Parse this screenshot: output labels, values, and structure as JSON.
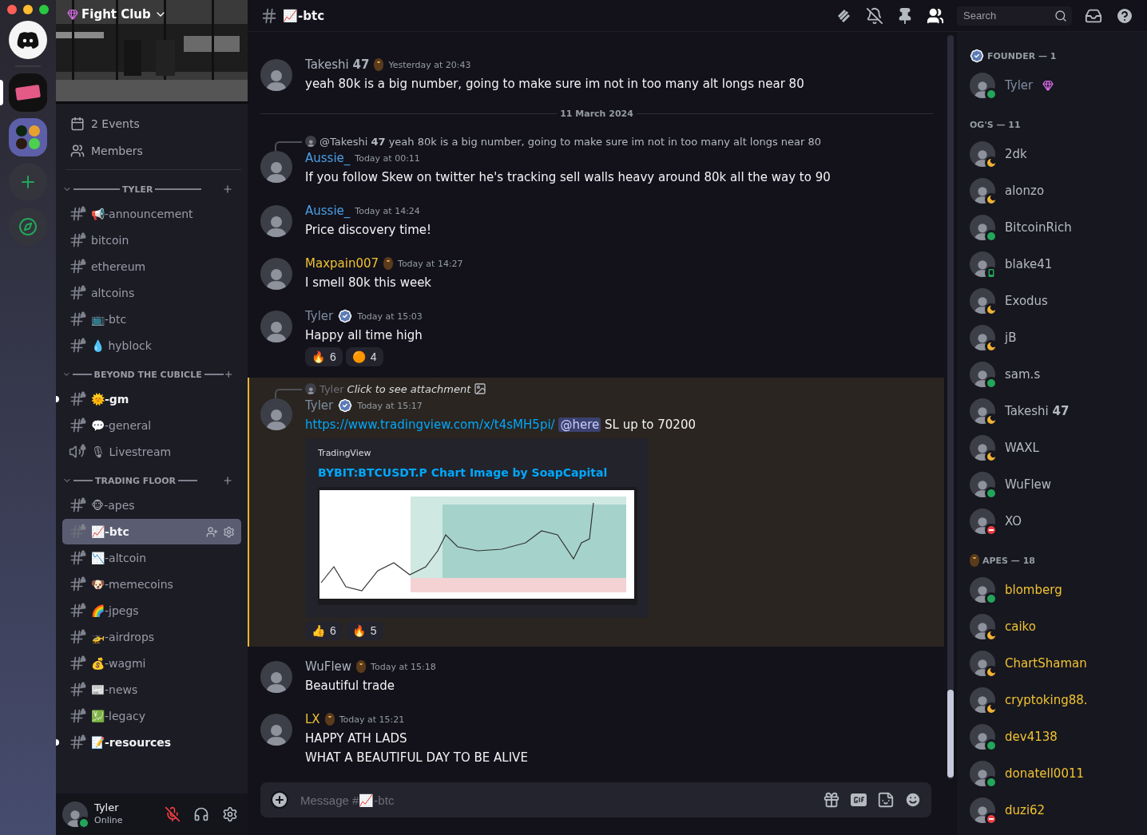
{
  "server": {
    "name": "Fight Club"
  },
  "rail": {
    "servers": [
      {
        "kind": "home"
      },
      {
        "kind": "server",
        "selected": true
      },
      {
        "kind": "folder",
        "selected": false
      },
      {
        "kind": "add"
      },
      {
        "kind": "explore"
      }
    ]
  },
  "sidebar": {
    "links": [
      {
        "kind": "events",
        "label": "2 Events"
      },
      {
        "kind": "members",
        "label": "Members"
      }
    ],
    "categories": [
      {
        "name": "TYLER",
        "expanded": true,
        "channels": [
          {
            "kind": "text",
            "name": "📢-announcement",
            "selected": false,
            "unread": false
          },
          {
            "kind": "text",
            "name": "bitcoin",
            "selected": false,
            "unread": false
          },
          {
            "kind": "text",
            "name": "ethereum",
            "selected": false,
            "unread": false
          },
          {
            "kind": "text",
            "name": "altcoins",
            "selected": false,
            "unread": false
          },
          {
            "kind": "text",
            "name": "📺-btc",
            "selected": false,
            "unread": false
          },
          {
            "kind": "text",
            "name": "💧 hyblock",
            "selected": false,
            "unread": false
          }
        ]
      },
      {
        "name": "BEYOND THE CUBICLE",
        "expanded": true,
        "channels": [
          {
            "kind": "text",
            "name": "🌞-gm",
            "selected": false,
            "unread": true
          },
          {
            "kind": "text",
            "name": "💬-general",
            "selected": false,
            "unread": false
          },
          {
            "kind": "voice",
            "name": "🎙 Livestream",
            "selected": false,
            "unread": false
          }
        ]
      },
      {
        "name": "TRADING FLOOR",
        "expanded": true,
        "channels": [
          {
            "kind": "text",
            "name": "🐵-apes",
            "selected": false,
            "unread": false
          },
          {
            "kind": "text",
            "name": "📈-btc",
            "selected": true,
            "unread": false
          },
          {
            "kind": "text",
            "name": "📉-altcoin",
            "selected": false,
            "unread": false
          },
          {
            "kind": "text",
            "name": "🐶-memecoins",
            "selected": false,
            "unread": false
          },
          {
            "kind": "text",
            "name": "🌈-jpegs",
            "selected": false,
            "unread": false
          },
          {
            "kind": "text",
            "name": "🚁-airdrops",
            "selected": false,
            "unread": false
          },
          {
            "kind": "text",
            "name": "💰-wagmi",
            "selected": false,
            "unread": false
          },
          {
            "kind": "text",
            "name": "📰-news",
            "selected": false,
            "unread": false
          },
          {
            "kind": "text",
            "name": "💹-legacy",
            "selected": false,
            "unread": false
          },
          {
            "kind": "text",
            "name": "📝-resources",
            "selected": false,
            "unread": true
          }
        ]
      }
    ]
  },
  "user_panel": {
    "name": "Tyler",
    "status": "Online",
    "muted": true
  },
  "header": {
    "channel": "📈-btc",
    "search_placeholder": "Search"
  },
  "messages": [
    {
      "kind": "message",
      "author": "Takeshi **47**",
      "color": "#aab2bd",
      "ape": true,
      "verified": false,
      "time": "Yesterday at 20:43",
      "lines": [
        "yeah 80k is a big number, going to make sure im not in too many alt longs near 80"
      ],
      "highlighted": false
    },
    {
      "kind": "divider",
      "label": "11 March 2024"
    },
    {
      "kind": "message",
      "reply": {
        "author": "@Takeshi **47**",
        "text": "yeah 80k is a big number, going to make sure im not in too many alt longs near 80",
        "italic": false
      },
      "author": "Aussie_",
      "color": "#4a9fe8",
      "ape": false,
      "verified": false,
      "time": "Today at 00:11",
      "lines": [
        "If you follow Skew on twitter he's tracking sell walls heavy around 80k all the way to 90"
      ],
      "highlighted": false
    },
    {
      "kind": "message",
      "author": "Aussie_",
      "color": "#4a9fe8",
      "ape": false,
      "verified": false,
      "time": "Today at 14:24",
      "lines": [
        "Price discovery time!"
      ],
      "highlighted": false
    },
    {
      "kind": "message",
      "author": "Maxpain007",
      "color": "#f0c232",
      "ape": true,
      "verified": false,
      "time": "Today at 14:27",
      "lines": [
        "I smell 80k this week"
      ],
      "highlighted": false
    },
    {
      "kind": "message",
      "author": "Tyler",
      "color": "#7d8ca3",
      "ape": false,
      "verified": true,
      "time": "Today at 15:03",
      "lines": [
        "Happy all time high"
      ],
      "highlighted": false,
      "reactions": [
        {
          "emoji": "🔥",
          "count": "6"
        },
        {
          "emoji": "🟠",
          "count": "4"
        }
      ]
    },
    {
      "kind": "message",
      "reply": {
        "author": "Tyler",
        "text": "Click to see attachment",
        "italic": true
      },
      "author": "Tyler",
      "color": "#7d8ca3",
      "ape": false,
      "verified": true,
      "time": "Today at 15:17",
      "link": "https://www.tradingview.com/x/t4sMH5pi/",
      "mention": "@here",
      "lines": [
        "SL up to 70200"
      ],
      "highlighted": true,
      "embed": {
        "provider": "TradingView",
        "title": "BYBIT:BTCUSDT.P Chart Image by SoapCapital"
      },
      "reactions": [
        {
          "emoji": "👍",
          "count": "6"
        },
        {
          "emoji": "🔥",
          "count": "5"
        }
      ]
    },
    {
      "kind": "message",
      "author": "WuFlew",
      "color": "#aab2bd",
      "ape": true,
      "verified": false,
      "time": "Today at 15:18",
      "lines": [
        "Beautiful trade"
      ],
      "highlighted": false
    },
    {
      "kind": "message",
      "author": "LX",
      "color": "#f0c232",
      "ape": true,
      "verified": false,
      "time": "Today at 15:21",
      "lines": [
        "HAPPY ATH LADS",
        "WHAT A BEAUTIFUL DAY TO BE ALIVE"
      ],
      "highlighted": false
    }
  ],
  "composer": {
    "placeholder": "Message #📈-btc"
  },
  "member_groups": [
    {
      "title": "FOUNDER — 1",
      "ape": false,
      "verified": true,
      "color": "#7d8ca3",
      "members": [
        {
          "name": "Tyler",
          "kind": "online",
          "boost": true
        }
      ]
    },
    {
      "title": "OG'S — 11",
      "ape": false,
      "verified": false,
      "color": "#b5bac1",
      "members": [
        {
          "name": "2dk",
          "kind": "idle"
        },
        {
          "name": "alonzo",
          "kind": "idle"
        },
        {
          "name": "BitcoinRich",
          "kind": "online"
        },
        {
          "name": "blake41",
          "kind": "mobile"
        },
        {
          "name": "Exodus",
          "kind": "idle"
        },
        {
          "name": "jB",
          "kind": "idle"
        },
        {
          "name": "sam.s",
          "kind": "online"
        },
        {
          "name": "Takeshi **47**",
          "kind": "idle"
        },
        {
          "name": "WAXL",
          "kind": "idle"
        },
        {
          "name": "WuFlew",
          "kind": "online"
        },
        {
          "name": "XO",
          "kind": "dnd"
        }
      ]
    },
    {
      "title": "APES — 18",
      "ape": true,
      "verified": false,
      "color": "#f0c232",
      "members": [
        {
          "name": "blomberg",
          "kind": "online"
        },
        {
          "name": "caiko",
          "kind": "idle"
        },
        {
          "name": "ChartShaman",
          "kind": "idle"
        },
        {
          "name": "cryptoking88.",
          "kind": "idle"
        },
        {
          "name": "dev4138",
          "kind": "online"
        },
        {
          "name": "donatell0011",
          "kind": "online"
        },
        {
          "name": "duzi62",
          "kind": "dnd"
        }
      ]
    }
  ]
}
